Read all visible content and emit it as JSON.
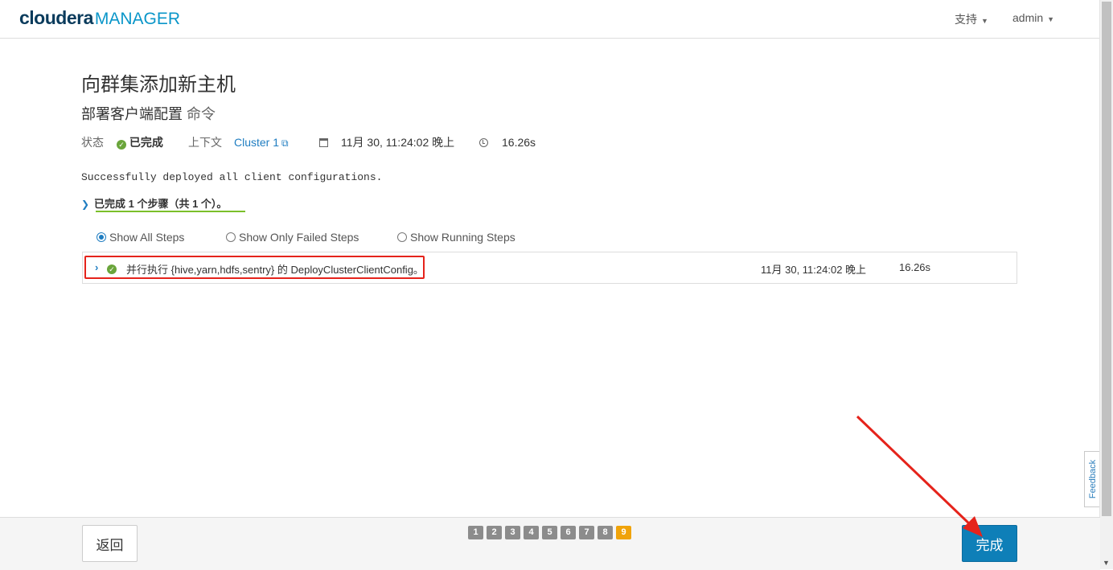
{
  "header": {
    "brand": "cloudera",
    "product": "MANAGER",
    "support_label": "支持",
    "user_label": "admin"
  },
  "page": {
    "title": "向群集添加新主机",
    "subtitle_main": "部署客户端配置",
    "subtitle_cmd": "命令"
  },
  "status": {
    "label": "状态",
    "value": "已完成",
    "context_label": "上下文",
    "context_link": "Cluster 1",
    "timestamp": "11月 30, 11:24:02 晚上",
    "duration": "16.26s"
  },
  "message": "Successfully deployed all client configurations.",
  "steps_summary": "已完成 1 个步骤（共 1 个）。",
  "filters": {
    "all": "Show All Steps",
    "failed": "Show Only Failed Steps",
    "running": "Show Running Steps",
    "selected": "all"
  },
  "steps": [
    {
      "description": "并行执行 {hive,yarn,hdfs,sentry} 的 DeployClusterClientConfig。",
      "timestamp": "11月 30, 11:24:02 晚上",
      "duration": "16.26s",
      "status": "completed"
    }
  ],
  "feedback_label": "Feedback",
  "footer": {
    "back_label": "返回",
    "finish_label": "完成",
    "pages": [
      "1",
      "2",
      "3",
      "4",
      "5",
      "6",
      "7",
      "8",
      "9"
    ],
    "current_page": "9"
  },
  "colors": {
    "accent": "#0e7fb8",
    "success": "#6aa53b",
    "current_page": "#f0a30a",
    "annotation": "#e5231b"
  }
}
